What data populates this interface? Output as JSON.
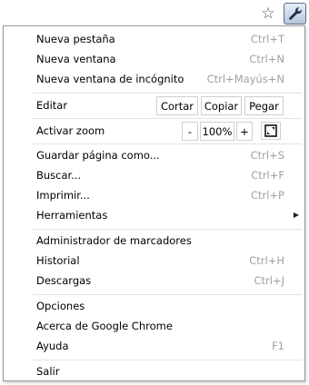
{
  "toolbar": {
    "star_icon": "star-icon",
    "star_glyph": "☆",
    "wrench_icon": "wrench-icon"
  },
  "menu": {
    "group1": [
      {
        "label": "Nueva pestaña",
        "shortcut": "Ctrl+T"
      },
      {
        "label": "Nueva ventana",
        "shortcut": "Ctrl+N"
      },
      {
        "label": "Nueva ventana de incógnito",
        "shortcut": "Ctrl+Mayús+N"
      }
    ],
    "edit": {
      "label": "Editar",
      "cut": "Cortar",
      "copy": "Copiar",
      "paste": "Pegar"
    },
    "zoom": {
      "label": "Activar zoom",
      "minus": "-",
      "value": "100%",
      "plus": "+",
      "fullscreen_icon": "fullscreen-icon"
    },
    "group3": [
      {
        "label": "Guardar página como...",
        "shortcut": "Ctrl+S"
      },
      {
        "label": "Buscar...",
        "shortcut": "Ctrl+F"
      },
      {
        "label": "Imprimir...",
        "shortcut": "Ctrl+P"
      },
      {
        "label": "Herramientas",
        "arrow": "▶"
      }
    ],
    "group4": [
      {
        "label": "Administrador de marcadores",
        "shortcut": ""
      },
      {
        "label": "Historial",
        "shortcut": "Ctrl+H"
      },
      {
        "label": "Descargas",
        "shortcut": "Ctrl+J"
      }
    ],
    "group5": [
      {
        "label": "Opciones",
        "shortcut": ""
      },
      {
        "label": "Acerca de Google Chrome",
        "shortcut": ""
      },
      {
        "label": "Ayuda",
        "shortcut": "F1"
      }
    ],
    "exit": {
      "label": "Salir"
    }
  }
}
